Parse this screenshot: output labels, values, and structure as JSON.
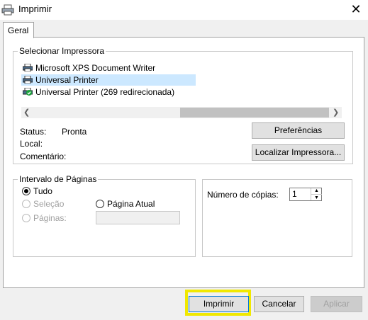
{
  "window": {
    "title": "Imprimir",
    "close_glyph": "✕"
  },
  "tabs": [
    {
      "label": "Geral"
    }
  ],
  "select_printer": {
    "legend": "Selecionar Impressora",
    "printers": [
      {
        "name": "Microsoft XPS Document Writer",
        "selected": false
      },
      {
        "name": "Universal Printer",
        "selected": true
      },
      {
        "name": "Universal Printer  (269 redirecionada)",
        "selected": false
      }
    ],
    "status_label": "Status:",
    "status_value": "Pronta",
    "location_label": "Local:",
    "location_value": "",
    "comment_label": "Comentário:",
    "comment_value": "",
    "preferences_button": "Preferências",
    "find_printer_button": "Localizar Impressora..."
  },
  "page_range": {
    "legend": "Intervalo de Páginas",
    "all_label": "Tudo",
    "selection_label": "Seleção",
    "current_page_label": "Página Atual",
    "pages_label": "Páginas:",
    "pages_value": "",
    "selected": "all"
  },
  "copies": {
    "label": "Número de cópias:",
    "value": "1"
  },
  "buttons": {
    "print": "Imprimir",
    "cancel": "Cancelar",
    "apply": "Aplicar"
  },
  "colors": {
    "selection": "#cce8ff",
    "highlight": "#f0e800"
  }
}
